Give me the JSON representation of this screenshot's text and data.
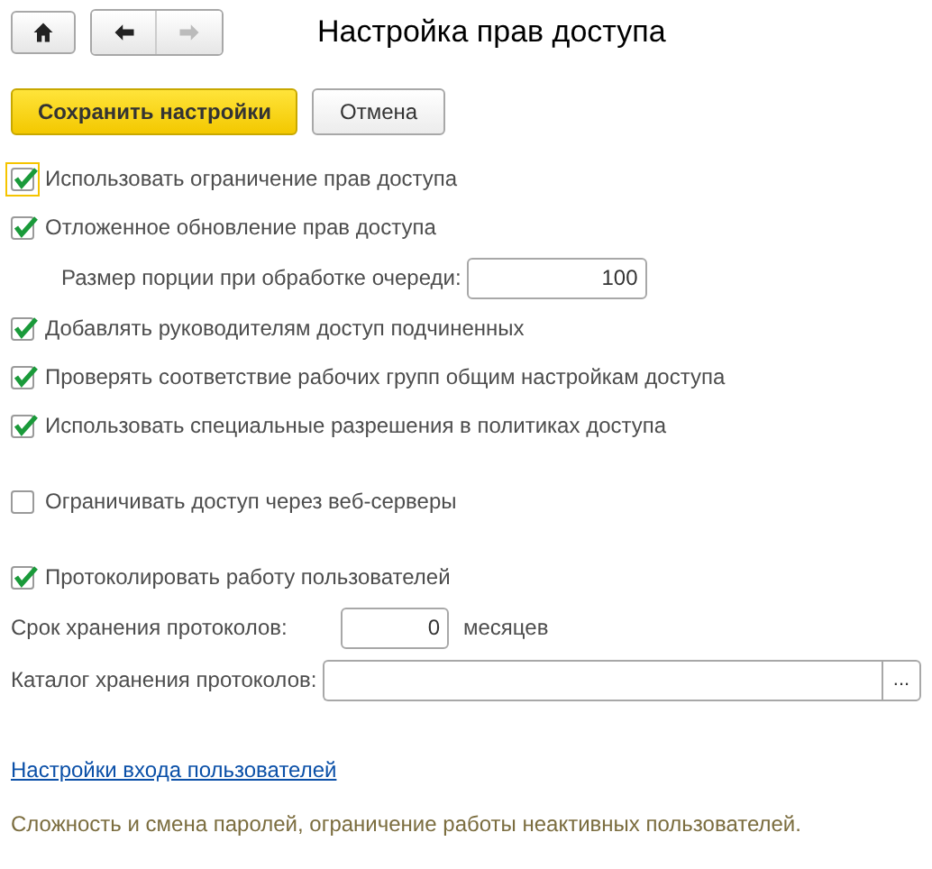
{
  "nav": {
    "home_enabled": true,
    "back_enabled": true,
    "forward_enabled": false
  },
  "title": "Настройка прав доступа",
  "buttons": [
    {
      "label": "Сохранить настройки",
      "kind": "primary"
    },
    {
      "label": "Отмена",
      "kind": "secondary"
    }
  ],
  "groups": [
    [
      {
        "kind": "checkbox",
        "label": "Использовать ограничение прав доступа",
        "checked": true,
        "focused": true
      },
      {
        "kind": "checkbox",
        "label": "Отложенное обновление прав доступа",
        "checked": true,
        "focused": false
      },
      {
        "kind": "sub-number",
        "label": "Размер порции при обработке очереди:",
        "value": "100"
      },
      {
        "kind": "checkbox",
        "label": "Добавлять руководителям доступ подчиненных",
        "checked": true,
        "focused": false
      },
      {
        "kind": "checkbox",
        "label": "Проверять соответствие рабочих групп общим настройкам доступа",
        "checked": true,
        "focused": false
      },
      {
        "kind": "checkbox",
        "label": "Использовать специальные разрешения в политиках доступа",
        "checked": true,
        "focused": false
      }
    ],
    [
      {
        "kind": "checkbox",
        "label": "Ограничивать доступ через веб-серверы",
        "checked": false,
        "focused": false
      }
    ],
    [
      {
        "kind": "checkbox",
        "label": "Протоколировать работу пользователей",
        "checked": true,
        "focused": false
      },
      {
        "kind": "number",
        "label": "Срок хранения протоколов:",
        "value": "0",
        "unit": "месяцев"
      },
      {
        "kind": "path",
        "label": "Каталог хранения протоколов:",
        "button": "..."
      }
    ]
  ],
  "link": "Настройки входа пользователей",
  "description": "Сложность и смена паролей, ограничение работы неактивных пользователей."
}
